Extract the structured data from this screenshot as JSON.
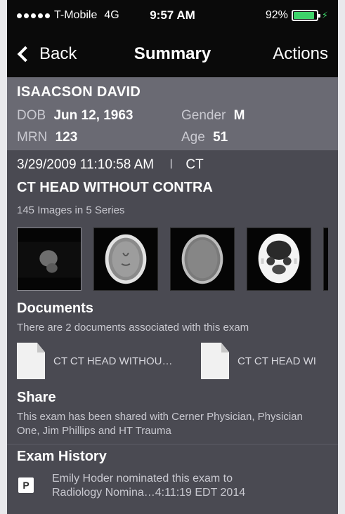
{
  "status_bar": {
    "carrier": "T-Mobile",
    "network": "4G",
    "time": "9:57 AM",
    "battery_percent_text": "92%",
    "battery_level": 0.92,
    "battery_color": "#3ed36a"
  },
  "nav": {
    "back_label": "Back",
    "title": "Summary",
    "actions_label": "Actions"
  },
  "patient": {
    "name": "ISAACSON DAVID",
    "dob_label": "DOB",
    "dob": "Jun 12, 1963",
    "gender_label": "Gender",
    "gender": "M",
    "mrn_label": "MRN",
    "mrn": "123",
    "age_label": "Age",
    "age": "51"
  },
  "exam": {
    "datetime": "3/29/2009 11:10:58 AM",
    "separator": "I",
    "modality": "CT",
    "description": "CT HEAD WITHOUT CONTRA",
    "image_count": "145 Images in 5 Series"
  },
  "documents": {
    "title": "Documents",
    "subtitle": "There are 2 documents associated with this exam",
    "items": [
      {
        "label": "CT CT HEAD WITHOU…"
      },
      {
        "label": "CT CT HEAD WI"
      }
    ]
  },
  "share": {
    "title": "Share",
    "text": "This exam has been shared with Cerner Physician, Physician One, Jim Phillips and HT Trauma"
  },
  "history": {
    "title": "Exam History",
    "items": [
      {
        "badge": "P",
        "line1": "Emily Hoder nominated this exam to",
        "line2": "Radiology Nomina…4:11:19 EDT 2014"
      }
    ]
  },
  "colors": {
    "header_bg": "#0a0a0a",
    "patient_bg": "#6a6a73",
    "content_bg": "#4a4a52"
  }
}
